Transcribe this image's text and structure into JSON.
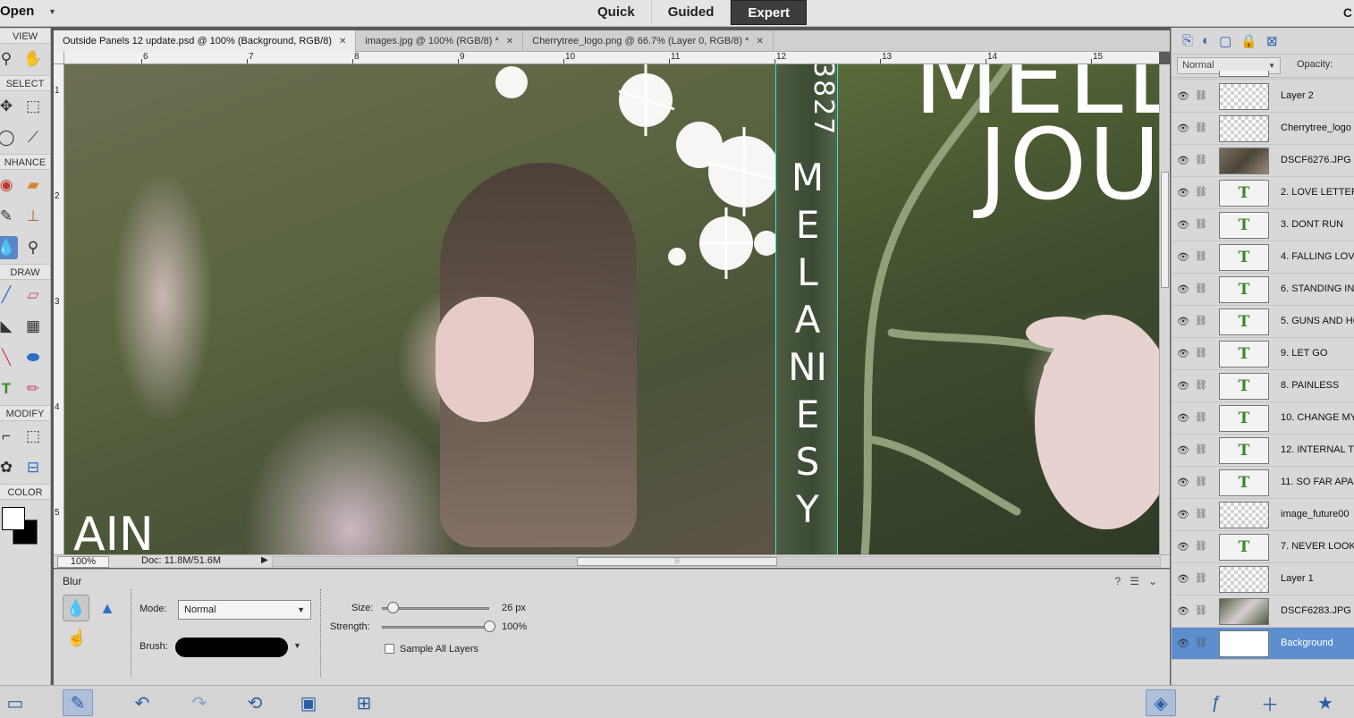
{
  "topbar": {
    "open_label": "Open",
    "modes": [
      {
        "label": "Quick",
        "active": false
      },
      {
        "label": "Guided",
        "active": false
      },
      {
        "label": "Expert",
        "active": true
      }
    ],
    "corner_label": "C"
  },
  "toolbar": {
    "sections": {
      "view": "VIEW",
      "select": "SELECT",
      "enhance": "NHANCE",
      "draw": "DRAW",
      "modify": "MODIFY",
      "color": "COLOR"
    },
    "foreground_color": "#ffffff",
    "background_color": "#000000"
  },
  "doc_tabs": [
    {
      "label": "Outside Panels 12 update.psd @ 100% (Background, RGB/8)",
      "active": true
    },
    {
      "label": "images.jpg @ 100% (RGB/8) *",
      "active": false
    },
    {
      "label": "Cherrytree_logo.png @ 66.7% (Layer 0, RGB/8) *",
      "active": false
    }
  ],
  "rulers": {
    "top": [
      "6",
      "7",
      "8",
      "9",
      "10",
      "11",
      "12",
      "13",
      "14",
      "15"
    ],
    "left": [
      "1",
      "2",
      "3",
      "4",
      "5"
    ]
  },
  "canvas_text": {
    "spine_number": "3827",
    "spine_name": "MELANIESY",
    "title_top": "MELL",
    "title_mid": "JOU",
    "title_left": "AIN"
  },
  "status": {
    "zoom": "100%",
    "doc_info": "Doc: 11.8M/51.6M"
  },
  "tool_options": {
    "title": "Blur",
    "mode_label": "Mode:",
    "mode_value": "Normal",
    "brush_label": "Brush:",
    "size_label": "Size:",
    "size_value": "26 px",
    "size_fraction": 0.1,
    "strength_label": "Strength:",
    "strength_value": "100%",
    "strength_fraction": 1.0,
    "sample_all_label": "Sample All Layers",
    "sample_all_checked": false
  },
  "layers_panel": {
    "blend_mode": "Normal",
    "opacity_label": "Opacity:",
    "layers": [
      {
        "name": "",
        "thumb": "text",
        "selected": false
      },
      {
        "name": "Layer 2",
        "thumb": "checker",
        "selected": false
      },
      {
        "name": "Cherrytree_logo",
        "thumb": "checker",
        "selected": false
      },
      {
        "name": "DSCF6276.JPG",
        "thumb": "photo",
        "selected": false
      },
      {
        "name": "2. LOVE LETTERS",
        "thumb": "text",
        "selected": false
      },
      {
        "name": "3. DONT RUN",
        "thumb": "text",
        "selected": false
      },
      {
        "name": "4. FALLING LOV",
        "thumb": "text",
        "selected": false
      },
      {
        "name": "6. STANDING IN",
        "thumb": "text",
        "selected": false
      },
      {
        "name": "5. GUNS AND HC",
        "thumb": "text",
        "selected": false
      },
      {
        "name": "9. LET GO",
        "thumb": "text",
        "selected": false
      },
      {
        "name": "8. PAINLESS",
        "thumb": "text",
        "selected": false
      },
      {
        "name": "10. CHANGE MY",
        "thumb": "text",
        "selected": false
      },
      {
        "name": "12. INTERNAL TE",
        "thumb": "text",
        "selected": false
      },
      {
        "name": "11. SO FAR APA",
        "thumb": "text",
        "selected": false
      },
      {
        "name": "image_future00",
        "thumb": "checker",
        "selected": false
      },
      {
        "name": "7. NEVER LOOK",
        "thumb": "text",
        "selected": false
      },
      {
        "name": "Layer 1",
        "thumb": "checker",
        "selected": false
      },
      {
        "name": "DSCF6283.JPG",
        "thumb": "photo2",
        "selected": false
      },
      {
        "name": "Background",
        "thumb": "white",
        "selected": true
      }
    ]
  },
  "colors": {
    "accent": "#5d8fcf",
    "guide": "#3ee0d8",
    "text_layer_icon": "#3b8a2a"
  },
  "icons": {
    "glyph_text_layer": "T"
  }
}
